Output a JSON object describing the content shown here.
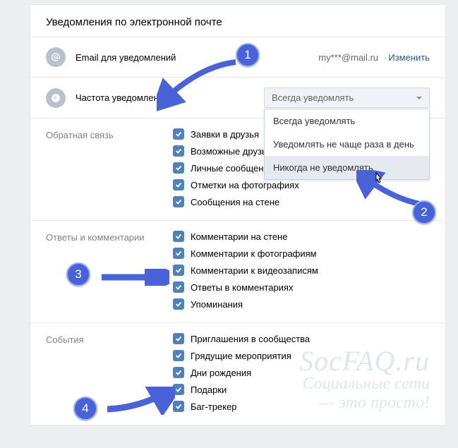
{
  "title": "Уведомления по электронной почте",
  "emailRow": {
    "label": "Email для уведомлений",
    "value": "my***@mail.ru",
    "changeLink": "Изменить",
    "dot": "·"
  },
  "freqRow": {
    "label": "Частота уведомлений",
    "selected": "Всегда уведомлять",
    "options": [
      "Всегда уведомлять",
      "Уведомлять не чаще раза в день",
      "Никогда не уведомлять"
    ]
  },
  "sections": [
    {
      "label": "Обратная связь",
      "items": [
        "Заявки в друзья",
        "Возможные друзья",
        "Личные сообщения",
        "Отметки на фотографиях",
        "Сообщения на стене"
      ]
    },
    {
      "label": "Ответы и комментарии",
      "items": [
        "Комментарии на стене",
        "Комментарии к фотографиям",
        "Комментарии к видеозаписям",
        "Ответы в комментариях",
        "Упоминания"
      ]
    },
    {
      "label": "События",
      "items": [
        "Приглашения в сообщества",
        "Грядущие мероприятия",
        "Дни рождения",
        "Подарки",
        "Баг-трекер"
      ]
    }
  ],
  "badges": {
    "b1": "1",
    "b2": "2",
    "b3": "3",
    "b4": "4"
  },
  "watermark": {
    "w1": "SocFAQ.ru",
    "w2": "Социальные сети",
    "w3": "— это просто!"
  }
}
